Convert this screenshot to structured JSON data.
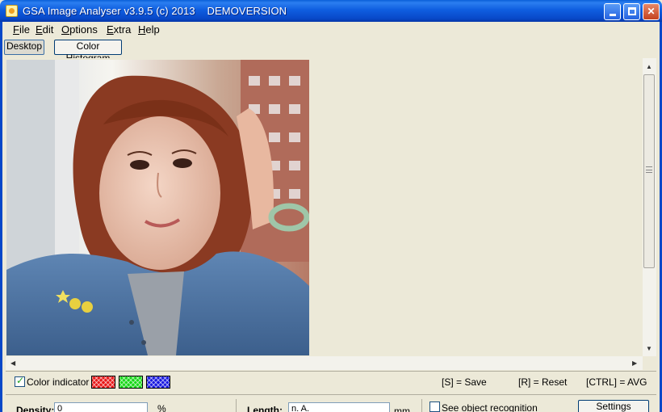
{
  "window": {
    "title": "GSA Image Analyser v3.9.5 (c) 2013    DEMOVERSION",
    "min_icon": "minimize-icon",
    "max_icon": "maximize-icon",
    "close_icon": "close-icon",
    "close_glyph": "✕"
  },
  "menu": [
    {
      "label_first": "F",
      "label_rest": "ile"
    },
    {
      "label_first": "E",
      "label_rest": "dit"
    },
    {
      "label_first": "O",
      "label_rest": "ptions"
    },
    {
      "label_first": "E",
      "label_rest": "xtra"
    },
    {
      "label_first": "H",
      "label_rest": "elp"
    }
  ],
  "toolbar": {
    "desktop_label": "Desktop",
    "histogram_label": "Color Histogram"
  },
  "scroll": {
    "up": "▲",
    "down": "▼",
    "left": "◀",
    "right": "▶"
  },
  "indicator": {
    "checkbox_label": "Color indicator",
    "checked": true,
    "swatch_colors": [
      "#e81818",
      "#18d818",
      "#1818e0"
    ]
  },
  "shortcuts": {
    "save": "[S] = Save",
    "reset": "[R] = Reset",
    "avg": "[CTRL] = AVG"
  },
  "measure": {
    "density_label": "Density:",
    "density_value": "0",
    "density_unit": "%",
    "length_label": "Length:",
    "length_value": "n. A.",
    "length_unit": "mm",
    "object_recognition_label": "See object recognition",
    "settings_label": "Settings"
  },
  "colors": {
    "titlebar": "#0848c8",
    "window_bg": "#ece9d8",
    "button_border": "#003c74"
  }
}
